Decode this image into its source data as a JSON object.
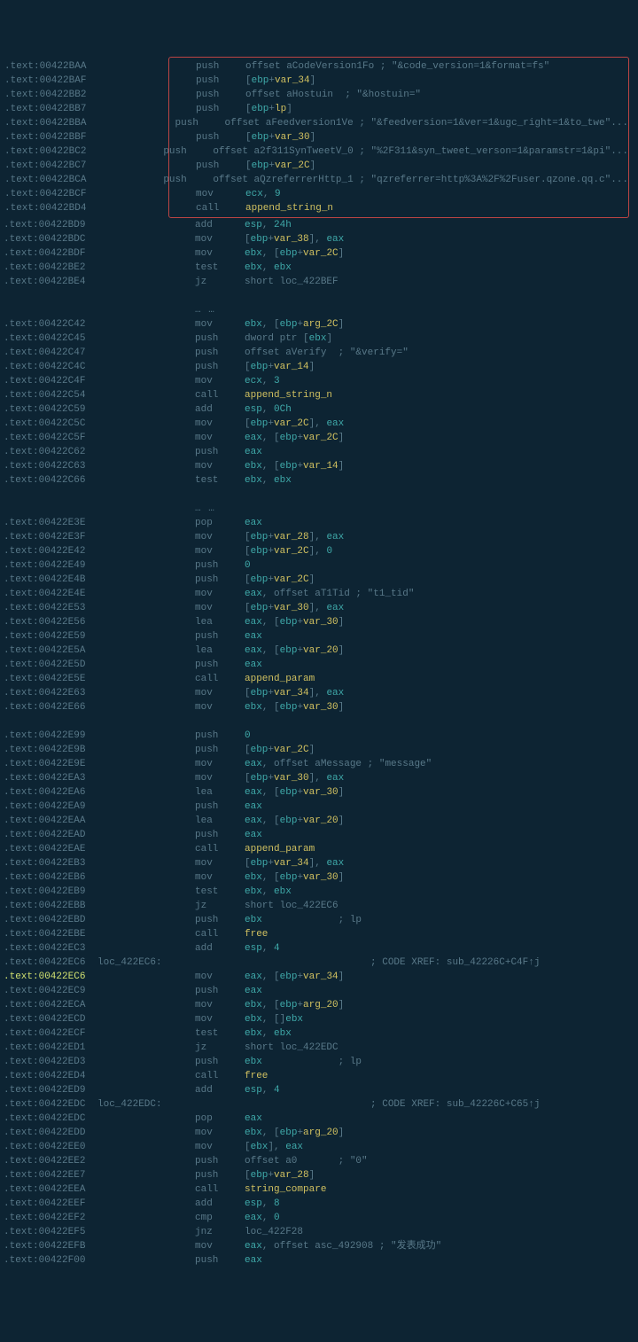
{
  "box": [
    {
      "a": ".text:00422BAA",
      "m": "push",
      "o": "offset aCodeVersion1Fo ; ",
      "c": "\"&code_version=1&format=fs\""
    },
    {
      "a": ".text:00422BAF",
      "m": "push",
      "o": "[",
      "r": "ebp",
      "o2": "+",
      "v": "var_34",
      "o3": "]"
    },
    {
      "a": ".text:00422BB2",
      "m": "push",
      "o": "offset aHostuin  ; ",
      "c": "\"&hostuin=\""
    },
    {
      "a": ".text:00422BB7",
      "m": "push",
      "o": "[",
      "r": "ebp",
      "o2": "+",
      "v": "lp",
      "o3": "]"
    },
    {
      "a": ".text:00422BBA",
      "m": "push",
      "o": "offset aFeedversion1Ve ; ",
      "c": "\"&feedversion=1&ver=1&ugc_right=1&to_twe\"..."
    },
    {
      "a": ".text:00422BBF",
      "m": "push",
      "o": "[",
      "r": "ebp",
      "o2": "+",
      "v": "var_30",
      "o3": "]"
    },
    {
      "a": ".text:00422BC2",
      "m": "push",
      "o": "offset a2f311SynTweetV_0 ; ",
      "c": "\"%2F311&syn_tweet_verson=1&paramstr=1&pi\"..."
    },
    {
      "a": ".text:00422BC7",
      "m": "push",
      "o": "[",
      "r": "ebp",
      "o2": "+",
      "v": "var_2C",
      "o3": "]"
    },
    {
      "a": ".text:00422BCA",
      "m": "push",
      "o": "offset aQzreferrerHttp_1 ; ",
      "c": "\"qzreferrer=http%3A%2F%2Fuser.qzone.qq.c\"..."
    },
    {
      "a": ".text:00422BCF",
      "m": "mov",
      "o": "",
      "r": "ecx",
      "o2": ", ",
      "n": "9"
    },
    {
      "a": ".text:00422BD4",
      "m": "call",
      "sym": "append_string_n"
    }
  ],
  "block1": [
    {
      "a": ".text:00422BD9",
      "m": "add",
      "r": "esp",
      "o2": ", ",
      "n": "24h"
    },
    {
      "a": ".text:00422BDC",
      "m": "mov",
      "o": "[",
      "r": "ebp",
      "o2": "+",
      "v": "var_38",
      "o3": "], ",
      "r2": "eax"
    },
    {
      "a": ".text:00422BDF",
      "m": "mov",
      "r": "ebx",
      "o2": ", [",
      "r2": "ebp",
      "o3": "+",
      "v": "var_2C",
      "o4": "]"
    },
    {
      "a": ".text:00422BE2",
      "m": "test",
      "r": "ebx",
      "o2": ", ",
      "r2": "ebx"
    },
    {
      "a": ".text:00422BE4",
      "m": "jz",
      "o": "short loc_422BEF"
    }
  ],
  "dots1": "… …",
  "block2": [
    {
      "a": ".text:00422C42",
      "m": "mov",
      "r": "ebx",
      "o2": ", [",
      "r2": "ebp",
      "o3": "+",
      "v": "arg_2C",
      "o4": "]"
    },
    {
      "a": ".text:00422C45",
      "m": "push",
      "o": "dword ptr [",
      "r": "ebx",
      "o2": "]"
    },
    {
      "a": ".text:00422C47",
      "m": "push",
      "o": "offset aVerify  ; ",
      "c": "\"&verify=\""
    },
    {
      "a": ".text:00422C4C",
      "m": "push",
      "o": "[",
      "r": "ebp",
      "o2": "+",
      "v": "var_14",
      "o3": "]"
    },
    {
      "a": ".text:00422C4F",
      "m": "mov",
      "r": "ecx",
      "o2": ", ",
      "n": "3"
    },
    {
      "a": ".text:00422C54",
      "m": "call",
      "sym": "append_string_n"
    },
    {
      "a": ".text:00422C59",
      "m": "add",
      "r": "esp",
      "o2": ", ",
      "n": "0Ch"
    },
    {
      "a": ".text:00422C5C",
      "m": "mov",
      "o": "[",
      "r": "ebp",
      "o2": "+",
      "v": "var_2C",
      "o3": "], ",
      "r2": "eax"
    },
    {
      "a": ".text:00422C5F",
      "m": "mov",
      "r": "eax",
      "o2": ", [",
      "r2": "ebp",
      "o3": "+",
      "v": "var_2C",
      "o4": "]"
    },
    {
      "a": ".text:00422C62",
      "m": "push",
      "r": "eax"
    },
    {
      "a": ".text:00422C63",
      "m": "mov",
      "r": "ebx",
      "o2": ", [",
      "r2": "ebp",
      "o3": "+",
      "v": "var_14",
      "o4": "]"
    },
    {
      "a": ".text:00422C66",
      "m": "test",
      "r": "ebx",
      "o2": ", ",
      "r2": "ebx"
    }
  ],
  "dots2": "… …",
  "block3": [
    {
      "a": ".text:00422E3E",
      "m": "pop",
      "r": "eax"
    },
    {
      "a": ".text:00422E3F",
      "m": "mov",
      "o": "[",
      "r": "ebp",
      "o2": "+",
      "v": "var_28",
      "o3": "], ",
      "r2": "eax"
    },
    {
      "a": ".text:00422E42",
      "m": "mov",
      "o": "[",
      "r": "ebp",
      "o2": "+",
      "v": "var_2C",
      "o3": "], ",
      "n": "0"
    },
    {
      "a": ".text:00422E49",
      "m": "push",
      "n": "0"
    },
    {
      "a": ".text:00422E4B",
      "m": "push",
      "o": "[",
      "r": "ebp",
      "o2": "+",
      "v": "var_2C",
      "o3": "]"
    },
    {
      "a": ".text:00422E4E",
      "m": "mov",
      "r": "eax",
      "o2": ", offset aT1Tid ; ",
      "c": "\"t1_tid\""
    },
    {
      "a": ".text:00422E53",
      "m": "mov",
      "o": "[",
      "r": "ebp",
      "o2": "+",
      "v": "var_30",
      "o3": "], ",
      "r2": "eax"
    },
    {
      "a": ".text:00422E56",
      "m": "lea",
      "r": "eax",
      "o2": ", [",
      "r2": "ebp",
      "o3": "+",
      "v": "var_30",
      "o4": "]"
    },
    {
      "a": ".text:00422E59",
      "m": "push",
      "r": "eax"
    },
    {
      "a": ".text:00422E5A",
      "m": "lea",
      "r": "eax",
      "o2": ", [",
      "r2": "ebp",
      "o3": "+",
      "v": "var_20",
      "o4": "]"
    },
    {
      "a": ".text:00422E5D",
      "m": "push",
      "r": "eax"
    },
    {
      "a": ".text:00422E5E",
      "m": "call",
      "sym": "append_param"
    },
    {
      "a": ".text:00422E63",
      "m": "mov",
      "o": "[",
      "r": "ebp",
      "o2": "+",
      "v": "var_34",
      "o3": "], ",
      "r2": "eax"
    },
    {
      "a": ".text:00422E66",
      "m": "mov",
      "r": "ebx",
      "o2": ", [",
      "r2": "ebp",
      "o3": "+",
      "v": "var_30",
      "o4": "]"
    }
  ],
  "block4": [
    {
      "a": ".text:00422E99",
      "m": "push",
      "n": "0"
    },
    {
      "a": ".text:00422E9B",
      "m": "push",
      "o": "[",
      "r": "ebp",
      "o2": "+",
      "v": "var_2C",
      "o3": "]"
    },
    {
      "a": ".text:00422E9E",
      "m": "mov",
      "r": "eax",
      "o2": ", offset aMessage ; ",
      "c": "\"message\""
    },
    {
      "a": ".text:00422EA3",
      "m": "mov",
      "o": "[",
      "r": "ebp",
      "o2": "+",
      "v": "var_30",
      "o3": "], ",
      "r2": "eax"
    },
    {
      "a": ".text:00422EA6",
      "m": "lea",
      "r": "eax",
      "o2": ", [",
      "r2": "ebp",
      "o3": "+",
      "v": "var_30",
      "o4": "]"
    },
    {
      "a": ".text:00422EA9",
      "m": "push",
      "r": "eax"
    },
    {
      "a": ".text:00422EAA",
      "m": "lea",
      "r": "eax",
      "o2": ", [",
      "r2": "ebp",
      "o3": "+",
      "v": "var_20",
      "o4": "]"
    },
    {
      "a": ".text:00422EAD",
      "m": "push",
      "r": "eax"
    },
    {
      "a": ".text:00422EAE",
      "m": "call",
      "sym": "append_param"
    },
    {
      "a": ".text:00422EB3",
      "m": "mov",
      "o": "[",
      "r": "ebp",
      "o2": "+",
      "v": "var_34",
      "o3": "], ",
      "r2": "eax"
    },
    {
      "a": ".text:00422EB6",
      "m": "mov",
      "r": "ebx",
      "o2": ", [",
      "r2": "ebp",
      "o3": "+",
      "v": "var_30",
      "o4": "]"
    },
    {
      "a": ".text:00422EB9",
      "m": "test",
      "r": "ebx",
      "o2": ", ",
      "r2": "ebx"
    },
    {
      "a": ".text:00422EBB",
      "m": "jz",
      "o": "short loc_422EC6"
    },
    {
      "a": ".text:00422EBD",
      "m": "push",
      "r": "ebx",
      "cmt": "             ; lp"
    },
    {
      "a": ".text:00422EBE",
      "m": "call",
      "sym": "free"
    },
    {
      "a": ".text:00422EC3",
      "m": "add",
      "r": "esp",
      "o2": ", ",
      "n": "4"
    },
    {
      "a": ".text:00422EC6",
      "m": "",
      "label": "loc_422EC6:",
      "xref": "                              ; CODE XREF: sub_42226C+C4F↑j"
    },
    {
      "a": ".text:00422EC6",
      "hl": true,
      "m": "mov",
      "r": "eax",
      "o2": ", [",
      "r2": "ebp",
      "o3": "+",
      "v": "var_34",
      "o4": "]"
    },
    {
      "a": ".text:00422EC9",
      "m": "push",
      "r": "eax"
    },
    {
      "a": ".text:00422ECA",
      "m": "mov",
      "r": "ebx",
      "o2": ", [",
      "r2": "ebp",
      "o3": "+",
      "v": "arg_20",
      "o4": "]"
    },
    {
      "a": ".text:00422ECD",
      "m": "mov",
      "r": "ebx",
      "o2": ", [",
      "r2": "ebx",
      "o3": "]"
    },
    {
      "a": ".text:00422ECF",
      "m": "test",
      "r": "ebx",
      "o2": ", ",
      "r2": "ebx"
    },
    {
      "a": ".text:00422ED1",
      "m": "jz",
      "o": "short loc_422EDC"
    },
    {
      "a": ".text:00422ED3",
      "m": "push",
      "r": "ebx",
      "cmt": "             ; lp"
    },
    {
      "a": ".text:00422ED4",
      "m": "call",
      "sym": "free"
    },
    {
      "a": ".text:00422ED9",
      "m": "add",
      "r": "esp",
      "o2": ", ",
      "n": "4"
    },
    {
      "a": ".text:00422EDC",
      "m": "",
      "label": "loc_422EDC:",
      "xref": "                              ; CODE XREF: sub_42226C+C65↑j"
    },
    {
      "a": ".text:00422EDC",
      "m": "pop",
      "r": "eax"
    },
    {
      "a": ".text:00422EDD",
      "m": "mov",
      "r": "ebx",
      "o2": ", [",
      "r2": "ebp",
      "o3": "+",
      "v": "arg_20",
      "o4": "]"
    },
    {
      "a": ".text:00422EE0",
      "m": "mov",
      "o": "[",
      "r": "ebx",
      "o2": "], ",
      "r2": "eax"
    },
    {
      "a": ".text:00422EE2",
      "m": "push",
      "o": "offset a0       ; ",
      "c": "\"0\""
    },
    {
      "a": ".text:00422EE7",
      "m": "push",
      "o": "[",
      "r": "ebp",
      "o2": "+",
      "v": "var_28",
      "o3": "]"
    },
    {
      "a": ".text:00422EEA",
      "m": "call",
      "sym": "string_compare"
    },
    {
      "a": ".text:00422EEF",
      "m": "add",
      "r": "esp",
      "o2": ", ",
      "n": "8"
    },
    {
      "a": ".text:00422EF2",
      "m": "cmp",
      "r": "eax",
      "o2": ", ",
      "n": "0"
    },
    {
      "a": ".text:00422EF5",
      "m": "jnz",
      "o": "loc_422F28"
    },
    {
      "a": ".text:00422EFB",
      "m": "mov",
      "r": "eax",
      "o2": ", offset asc_492908 ; ",
      "c": "\"发表成功\""
    },
    {
      "a": ".text:00422F00",
      "m": "push",
      "r": "eax"
    }
  ]
}
